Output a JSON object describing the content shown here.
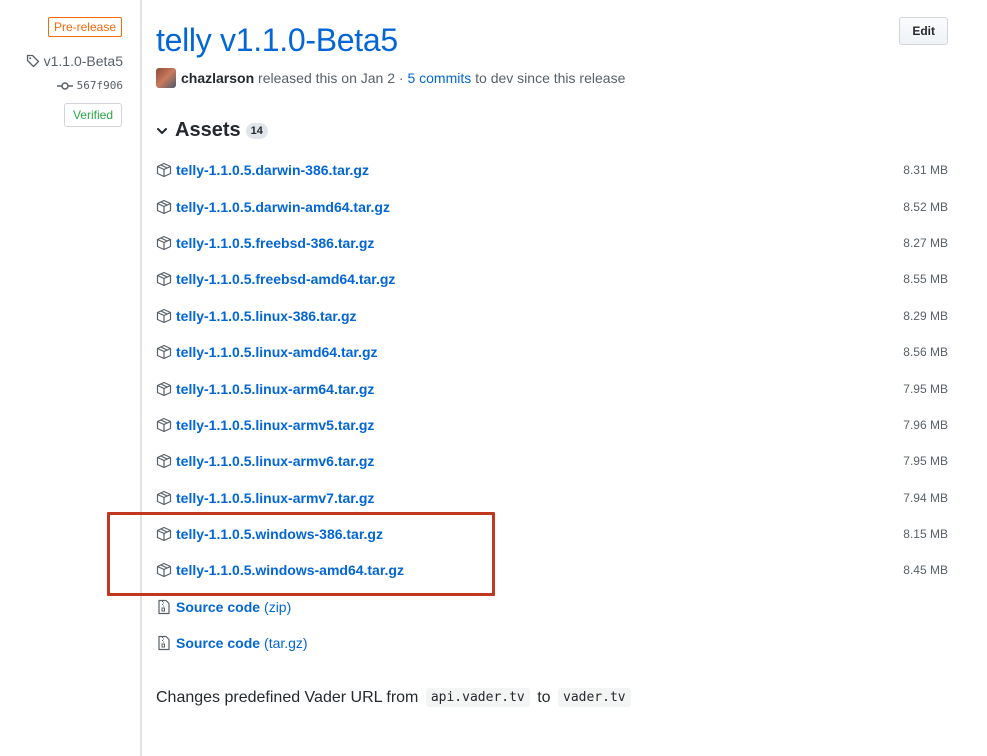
{
  "release": {
    "prerelease_badge": "Pre-release",
    "tag": "v1.1.0-Beta5",
    "commit": "567f906",
    "verified": "Verified",
    "title": "telly v1.1.0-Beta5",
    "edit_label": "Edit",
    "author": "chazlarson",
    "released_text": "released this on Jan 2",
    "separator": "·",
    "commits_link": "5 commits",
    "commits_suffix": "to dev since this release"
  },
  "assets": {
    "heading": "Assets",
    "count": "14",
    "items": [
      {
        "name": "telly-1.1.0.5.darwin-386.tar.gz",
        "size": "8.31 MB"
      },
      {
        "name": "telly-1.1.0.5.darwin-amd64.tar.gz",
        "size": "8.52 MB"
      },
      {
        "name": "telly-1.1.0.5.freebsd-386.tar.gz",
        "size": "8.27 MB"
      },
      {
        "name": "telly-1.1.0.5.freebsd-amd64.tar.gz",
        "size": "8.55 MB"
      },
      {
        "name": "telly-1.1.0.5.linux-386.tar.gz",
        "size": "8.29 MB"
      },
      {
        "name": "telly-1.1.0.5.linux-amd64.tar.gz",
        "size": "8.56 MB"
      },
      {
        "name": "telly-1.1.0.5.linux-arm64.tar.gz",
        "size": "7.95 MB"
      },
      {
        "name": "telly-1.1.0.5.linux-armv5.tar.gz",
        "size": "7.96 MB"
      },
      {
        "name": "telly-1.1.0.5.linux-armv6.tar.gz",
        "size": "7.95 MB"
      },
      {
        "name": "telly-1.1.0.5.linux-armv7.tar.gz",
        "size": "7.94 MB"
      },
      {
        "name": "telly-1.1.0.5.windows-386.tar.gz",
        "size": "8.15 MB"
      },
      {
        "name": "telly-1.1.0.5.windows-amd64.tar.gz",
        "size": "8.45 MB"
      }
    ],
    "source": [
      {
        "label": "Source code",
        "format": "(zip)"
      },
      {
        "label": "Source code",
        "format": "(tar.gz)"
      }
    ]
  },
  "notes": {
    "prefix": "Changes predefined Vader URL from",
    "from_code": "api.vader.tv",
    "middle": "to",
    "to_code": "vader.tv"
  },
  "colors": {
    "link": "#0366d6",
    "prerelease": "#f66a0a",
    "verified": "#28a745",
    "highlight": "#c0391e"
  },
  "icons": {
    "tag": "tag-icon",
    "commit": "git-commit-icon",
    "chevron": "chevron-down-icon",
    "package": "package-icon",
    "file_zip": "file-zip-icon"
  }
}
